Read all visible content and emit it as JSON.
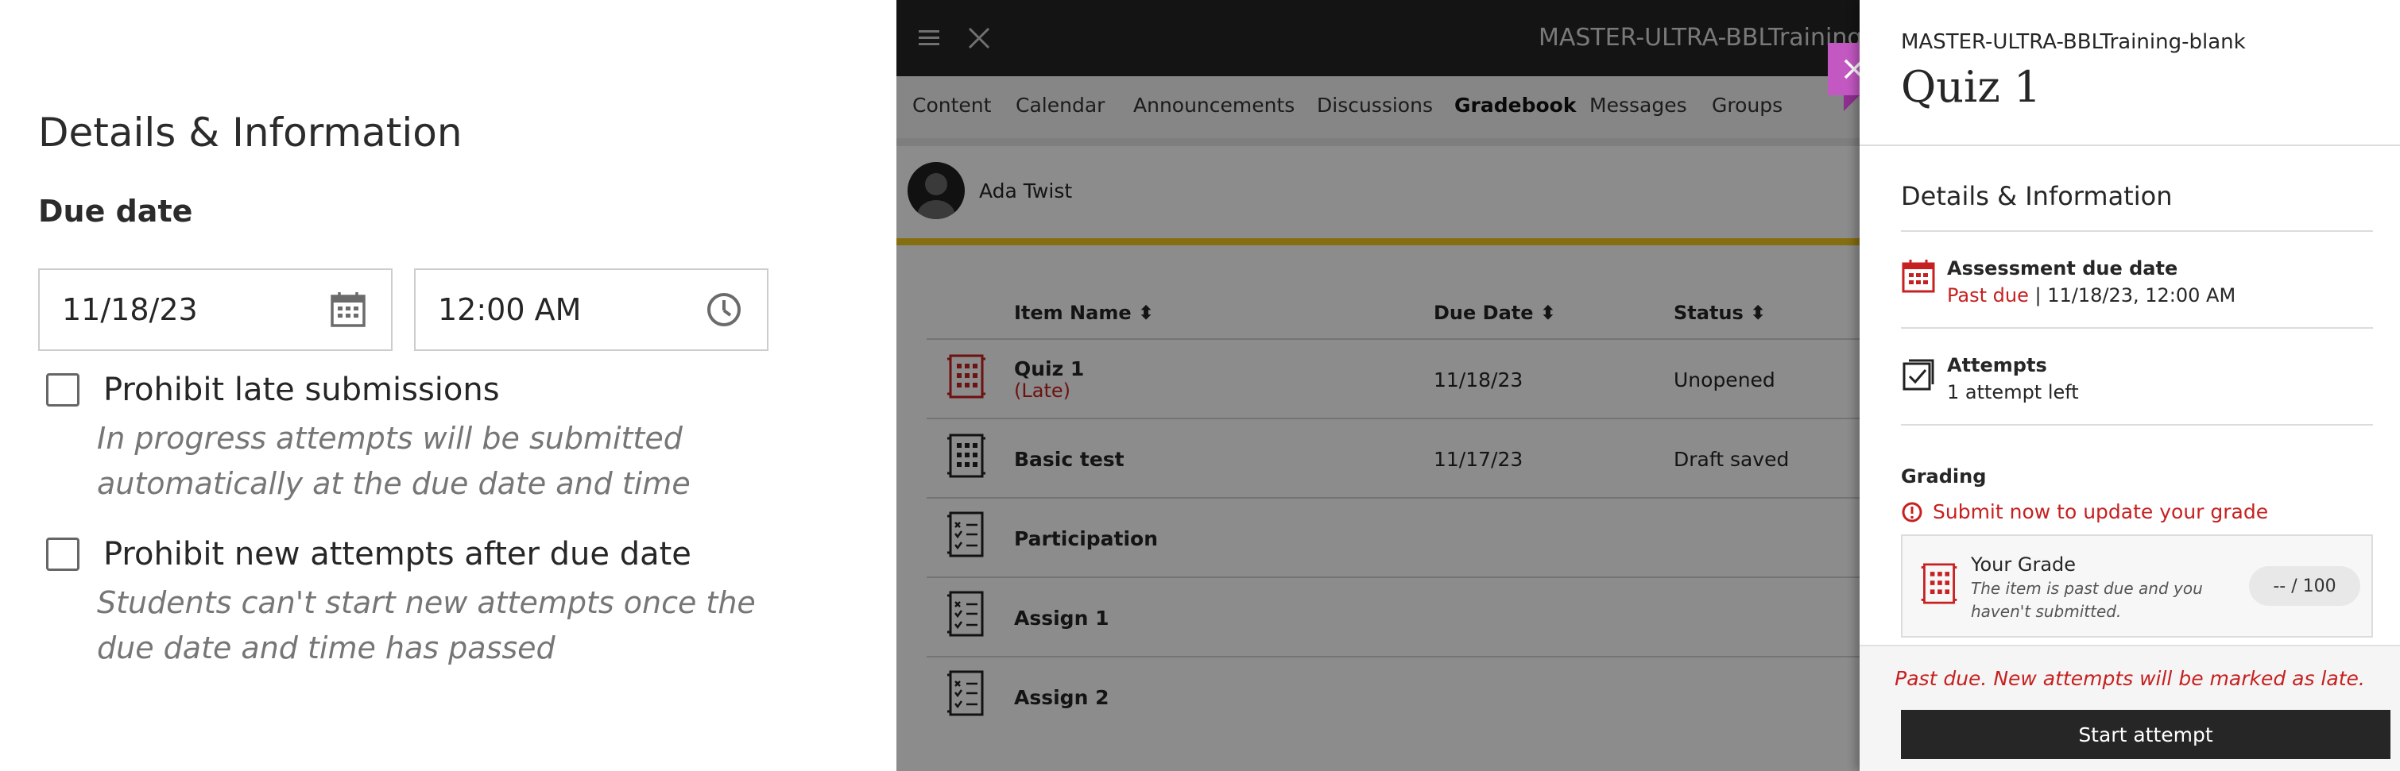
{
  "settings": {
    "section_title": "Details & Information",
    "due_date_label": "Due date",
    "date_value": "11/18/23",
    "time_value": "12:00 AM",
    "prohibit_late_label": "Prohibit late submissions",
    "prohibit_late_hint": "In progress attempts will be submitted automatically at the due date and time",
    "prohibit_new_label": "Prohibit new attempts after due date",
    "prohibit_new_hint": "Students can't start new attempts once the due date and time has passed",
    "prohibit_late_checked": false,
    "prohibit_new_checked": false
  },
  "ultra": {
    "course_title": "MASTER-ULTRA-BBLTraining-bl",
    "nav": [
      "Content",
      "Calendar",
      "Announcements",
      "Discussions",
      "Gradebook",
      "Messages",
      "Groups"
    ],
    "active_nav": "Gradebook",
    "student_name": "Ada Twist",
    "columns": {
      "item_name": "Item Name ⬍",
      "due_date": "Due Date ⬍",
      "status": "Status ⬍"
    },
    "rows": [
      {
        "name": "Quiz 1",
        "sub": "(Late)",
        "due": "11/18/23",
        "status": "Unopened",
        "icon": "test-icon-red"
      },
      {
        "name": "Basic test",
        "sub": "",
        "due": "11/17/23",
        "status": "Draft saved",
        "icon": "test-icon"
      },
      {
        "name": "Participation",
        "sub": "",
        "due": "",
        "status": "",
        "icon": "checklist-icon"
      },
      {
        "name": "Assign 1",
        "sub": "",
        "due": "",
        "status": "",
        "icon": "checklist-icon"
      },
      {
        "name": "Assign 2",
        "sub": "",
        "due": "",
        "status": "",
        "icon": "checklist-icon"
      }
    ]
  },
  "peek": {
    "course": "MASTER-ULTRA-BBLTraining-blank",
    "title": "Quiz 1",
    "section_title": "Details & Information",
    "due_label": "Assessment due date",
    "due_status": "Past due",
    "due_separator": " | ",
    "due_value": "11/18/23, 12:00 AM",
    "attempts_label": "Attempts",
    "attempts_value": "1 attempt left",
    "grading_title": "Grading",
    "grading_alert": "Submit now to update your grade",
    "grade_label": "Your Grade",
    "grade_desc": "The item is past due and you haven't submitted.",
    "grade_value": "-- / 100",
    "late_note": "Past due. New attempts will be marked as late.",
    "start_button": "Start attempt"
  },
  "colors": {
    "accent_red": "#c72020",
    "close_tab": "#c358c3",
    "highlight_yellow": "#f3c81e",
    "topbar": "#262626"
  }
}
